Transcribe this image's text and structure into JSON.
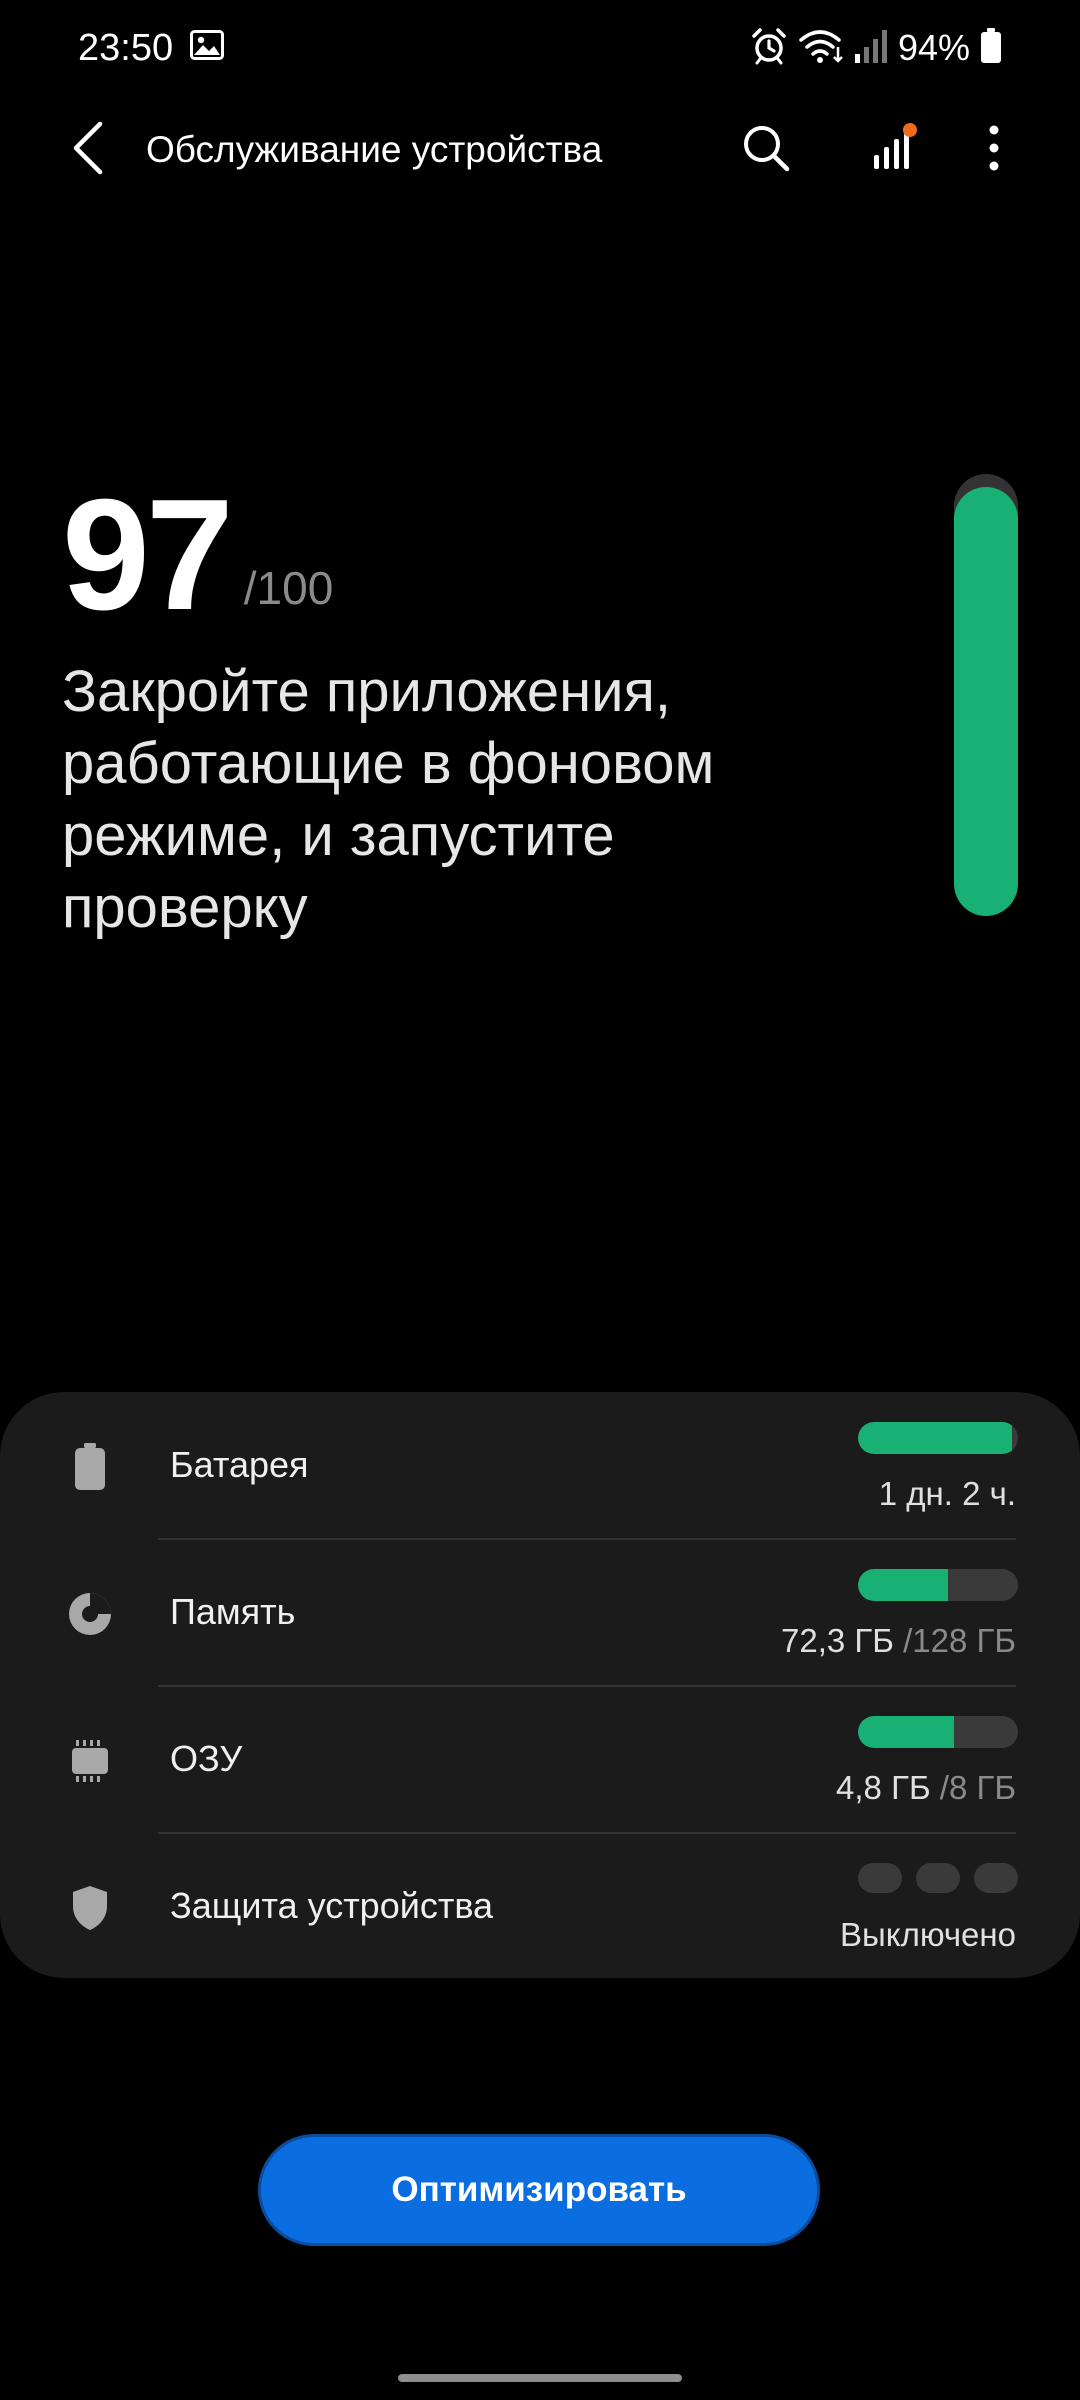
{
  "status_bar": {
    "time": "23:50",
    "battery_percent": "94%",
    "icons": [
      "gallery-icon",
      "alarm-icon",
      "wifi-icon",
      "cellular-signal-icon",
      "battery-icon"
    ]
  },
  "app_bar": {
    "title": "Обслуживание устройства",
    "icons": [
      "back-arrow-icon",
      "search-icon",
      "stats-icon",
      "more-options-icon"
    ],
    "notification_dot_color": "#f26a1b"
  },
  "score": {
    "value": "97",
    "max": "/100",
    "message": "Закройте приложения, работающие в фоновом режиме, и запустите проверку",
    "fill_fraction": 0.97,
    "color": "#18b173"
  },
  "items": [
    {
      "id": "battery",
      "label": "Батарея",
      "icon": "battery-icon",
      "value": "1 дн. 2 ч.",
      "total": "",
      "fill_fraction": 0.96
    },
    {
      "id": "storage",
      "label": "Память",
      "icon": "storage-pie-icon",
      "value": "72,3 ГБ",
      "total": "/128 ГБ",
      "fill_fraction": 0.565
    },
    {
      "id": "ram",
      "label": "ОЗУ",
      "icon": "ram-chip-icon",
      "value": "4,8 ГБ",
      "total": "/8 ГБ",
      "fill_fraction": 0.6
    },
    {
      "id": "security",
      "label": "Защита устройства",
      "icon": "shield-icon",
      "value": "Выключено",
      "total": ""
    }
  ],
  "optimize_button": {
    "label": "Оптимизировать",
    "color": "#0b6ee0"
  },
  "colors": {
    "accent_green": "#18b173",
    "card_background": "#1b1b1b"
  }
}
